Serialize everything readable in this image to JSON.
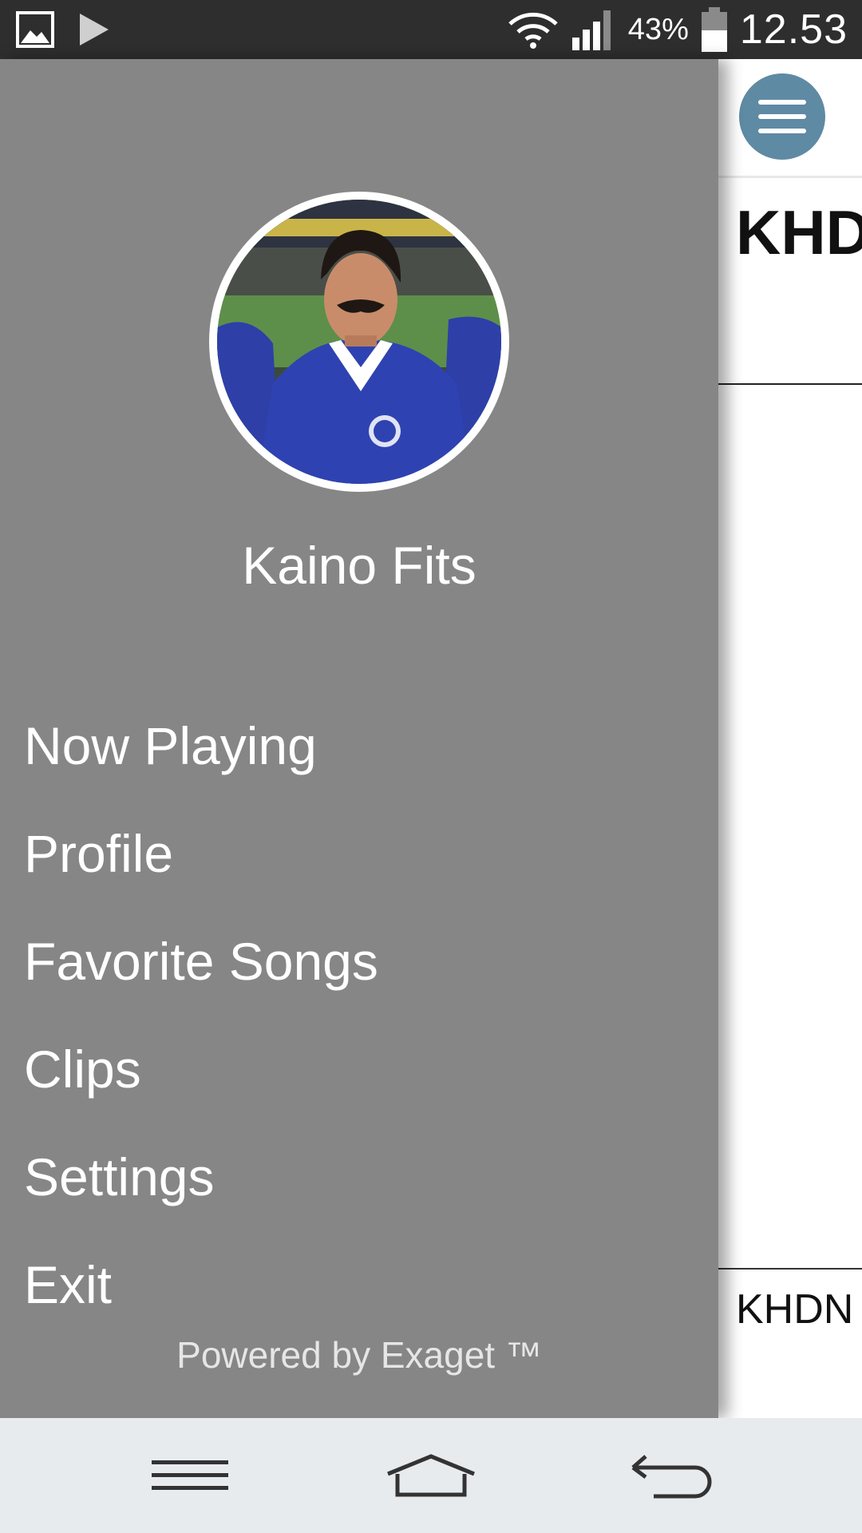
{
  "status_bar": {
    "battery_percent": "43%",
    "time": "12.53"
  },
  "drawer": {
    "user_name": "Kaino Fits",
    "menu": [
      {
        "label": "Now Playing"
      },
      {
        "label": "Profile"
      },
      {
        "label": "Favorite Songs"
      },
      {
        "label": "Clips"
      },
      {
        "label": "Settings"
      },
      {
        "label": "Exit"
      }
    ],
    "footer": "Powered by Exaget ™"
  },
  "background_screen": {
    "title_fragment": "KHD",
    "bottom_label_fragment": "KHDN"
  },
  "colors": {
    "drawer_bg": "#868686",
    "hamburger_bg": "#5f8aa3",
    "status_bar_bg": "#2e2e2e",
    "nav_bar_bg": "#e8ebee"
  }
}
